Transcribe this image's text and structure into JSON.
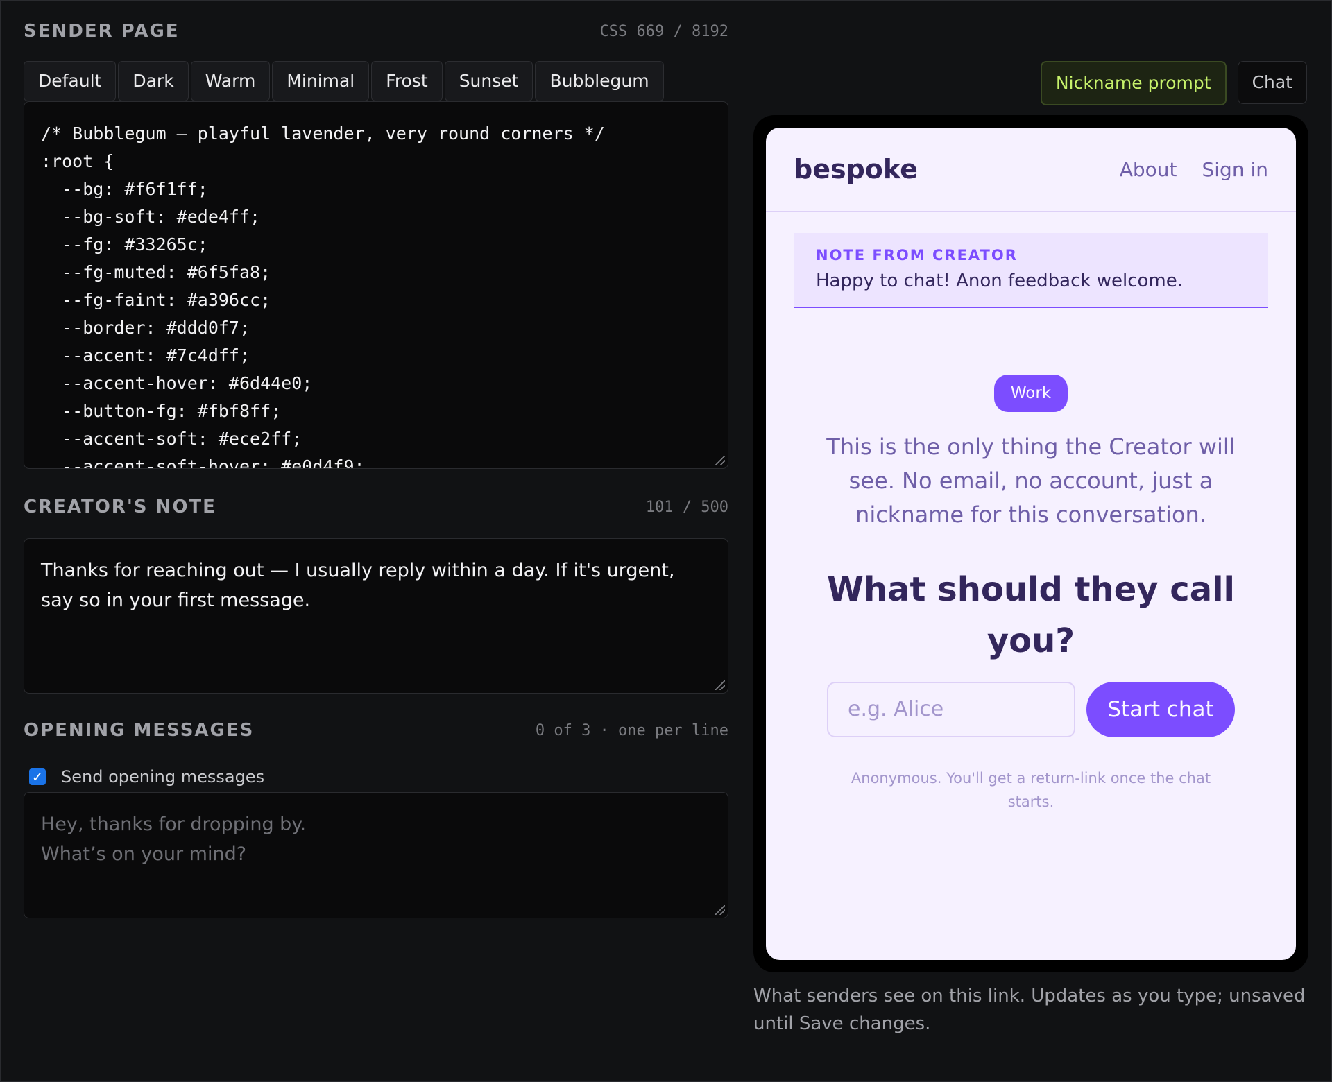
{
  "sender": {
    "title": "SENDER PAGE",
    "css_count": "CSS 669 / 8192",
    "presets": [
      "Default",
      "Dark",
      "Warm",
      "Minimal",
      "Frost",
      "Sunset",
      "Bubblegum"
    ],
    "css_text": "/* Bubblegum — playful lavender, very round corners */\n:root {\n  --bg: #f6f1ff;\n  --bg-soft: #ede4ff;\n  --fg: #33265c;\n  --fg-muted: #6f5fa8;\n  --fg-faint: #a396cc;\n  --border: #ddd0f7;\n  --accent: #7c4dff;\n  --accent-hover: #6d44e0;\n  --button-fg: #fbf8ff;\n  --accent-soft: #ece2ff;\n  --accent-soft-hover: #e0d4f9;"
  },
  "creator_note": {
    "title": "CREATOR'S NOTE",
    "count": "101 / 500",
    "value": "Thanks for reaching out — I usually reply within a day. If it's urgent, say so in your first message."
  },
  "opening": {
    "title": "OPENING MESSAGES",
    "count": "0 of 3 · one per line",
    "checkbox_label": "Send opening messages",
    "checked": true,
    "placeholder_line1": "Hey, thanks for dropping by.",
    "placeholder_line2": "What’s on your mind?"
  },
  "preview_tabs": {
    "nickname": "Nickname prompt",
    "chat": "Chat"
  },
  "preview": {
    "brand": "bespoke",
    "nav": [
      "About",
      "Sign in"
    ],
    "note_label": "NOTE FROM CREATOR",
    "note_text": "Happy to chat! Anon feedback welcome.",
    "badge": "Work",
    "intro": "This is the only thing the Creator will see. No email, no account, just a nickname for this conversation.",
    "question": "What should they call you?",
    "input_placeholder": "e.g. Alice",
    "start_button": "Start chat",
    "fine_print": "Anonymous. You'll get a return-link once the chat starts."
  },
  "caption": "What senders see on this link. Updates as you type; unsaved until Save changes.",
  "colors": {
    "accent": "#7c4dff",
    "bg": "#f6f1ff",
    "fg": "#33265c",
    "active_tab": "#c7f26b"
  }
}
